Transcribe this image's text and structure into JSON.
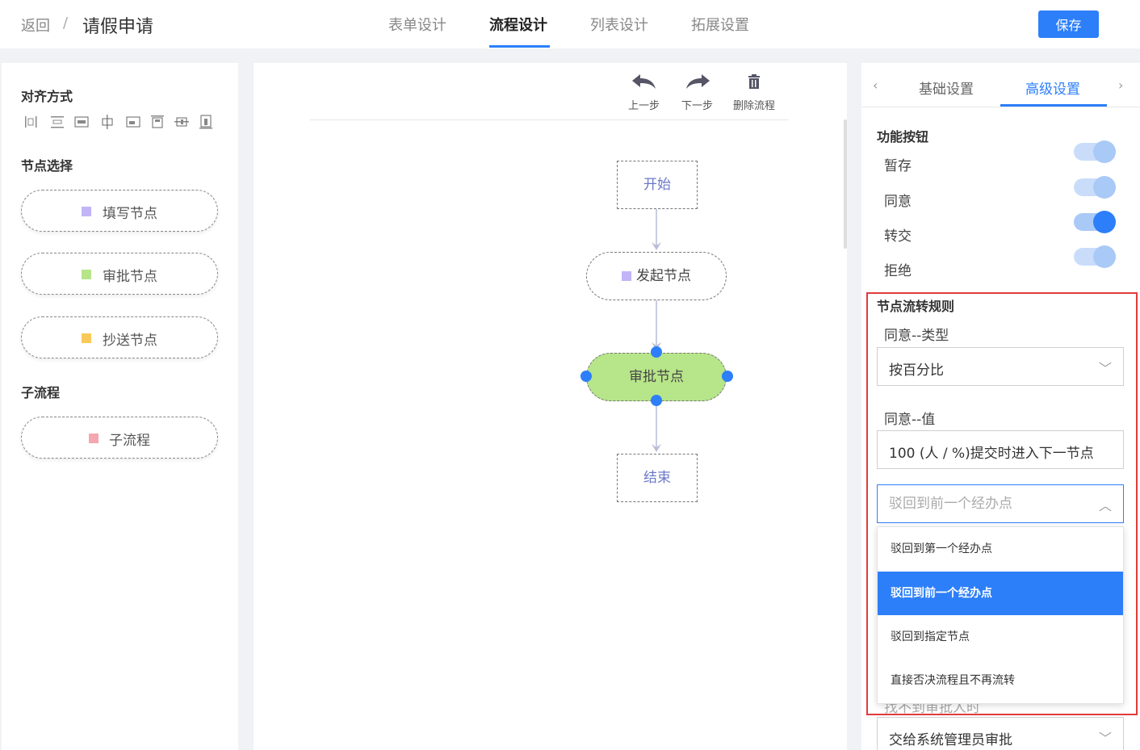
{
  "header": {
    "back": "返回",
    "separator": "/",
    "title": "请假申请",
    "tabs": [
      "表单设计",
      "流程设计",
      "列表设计",
      "拓展设置"
    ],
    "save_label": "保存"
  },
  "left": {
    "align_title": "对齐方式",
    "node_title": "节点选择",
    "nodes": [
      "填写节点",
      "审批节点",
      "抄送节点"
    ],
    "subflow_title": "子流程",
    "subflow": "子流程",
    "colors": {
      "fill": "#c2b4f7",
      "approve": "#b7e58a",
      "cc": "#f9c95b",
      "subflow": "#f4a7b0"
    }
  },
  "toolbar": {
    "undo": "上一步",
    "redo": "下一步",
    "delete": "删除流程"
  },
  "flow": {
    "start": "开始",
    "initiate": "发起节点",
    "approve": "审批节点",
    "end": "结束"
  },
  "right": {
    "tabs": [
      "基础设置",
      "高级设置"
    ],
    "func_title": "功能按钮",
    "buttons": [
      {
        "label": "暂存",
        "on": false
      },
      {
        "label": "同意",
        "on": false
      },
      {
        "label": "转交",
        "on": true
      },
      {
        "label": "拒绝",
        "on": false
      }
    ],
    "rule_title": "节点流转规则",
    "agree_type_label": "同意--类型",
    "agree_type_value": "按百分比",
    "agree_value_label": "同意--值",
    "agree_value": "100 (人 / %)提交时进入下一节点",
    "reject_placeholder": "驳回到前一个经办点",
    "options": [
      "驳回到第一个经办点",
      "驳回到前一个经办点",
      "驳回到指定节点",
      "直接否决流程且不再流转"
    ],
    "selected_index": 1,
    "hidden_label": "找不到审批人时",
    "bottom_select": "交给系统管理员审批"
  }
}
